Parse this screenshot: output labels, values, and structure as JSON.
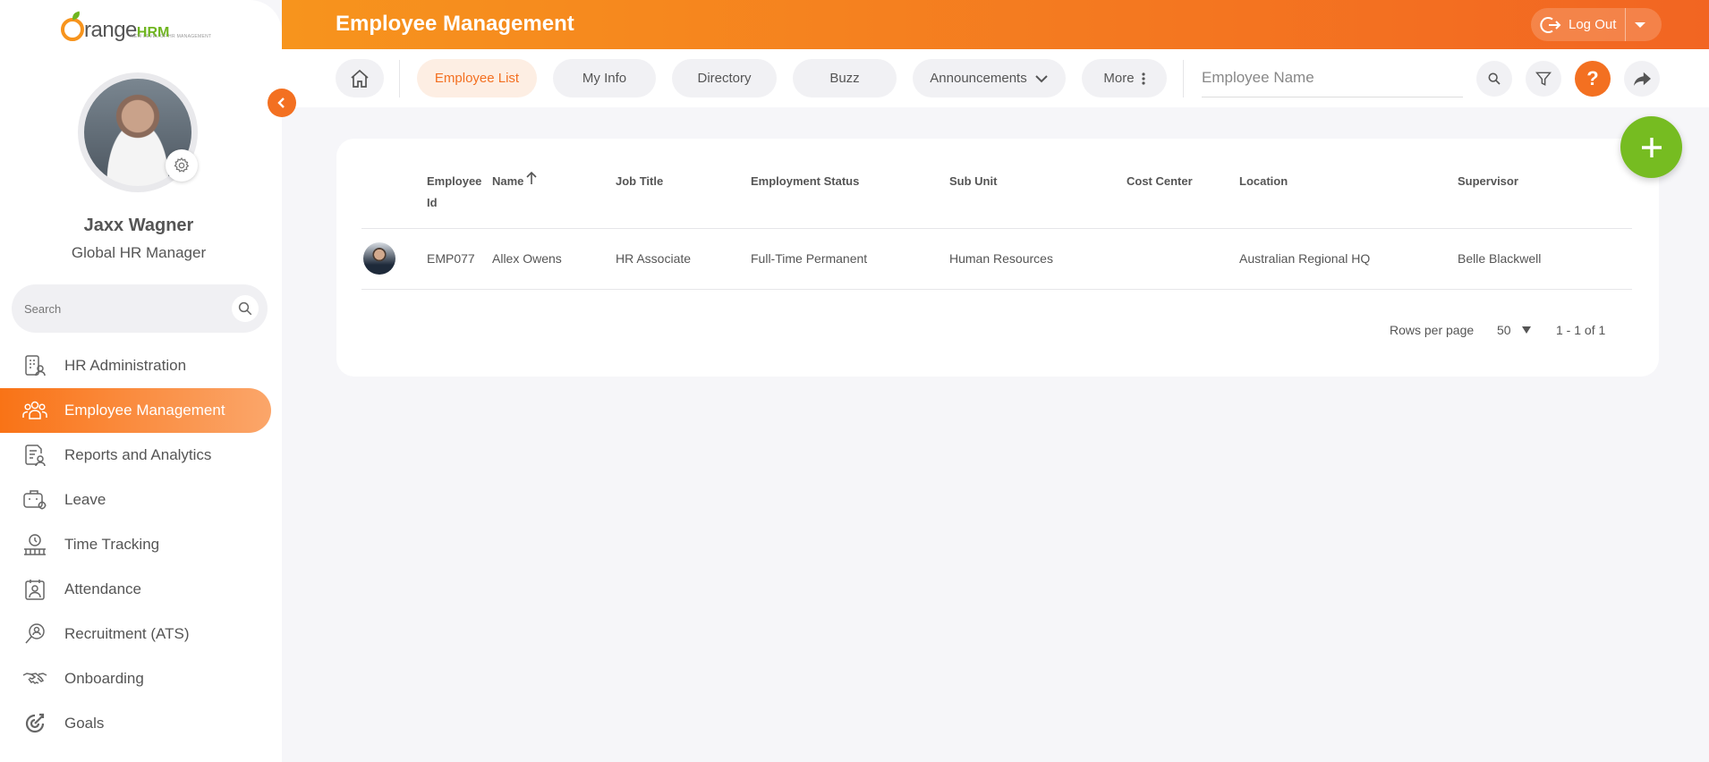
{
  "app": {
    "logo_text_main": "range",
    "logo_text_brand": "HRM",
    "logo_tagline": "NEW LEVEL OF HR MANAGEMENT"
  },
  "user": {
    "name": "Jaxx Wagner",
    "role": "Global HR Manager"
  },
  "sidebar": {
    "search_placeholder": "Search",
    "items": [
      {
        "label": "HR Administration",
        "icon": "hr-admin-icon",
        "active": false
      },
      {
        "label": "Employee Management",
        "icon": "employee-management-icon",
        "active": true
      },
      {
        "label": "Reports and Analytics",
        "icon": "reports-icon",
        "active": false
      },
      {
        "label": "Leave",
        "icon": "leave-icon",
        "active": false
      },
      {
        "label": "Time Tracking",
        "icon": "time-tracking-icon",
        "active": false
      },
      {
        "label": "Attendance",
        "icon": "attendance-icon",
        "active": false
      },
      {
        "label": "Recruitment (ATS)",
        "icon": "recruitment-icon",
        "active": false
      },
      {
        "label": "Onboarding",
        "icon": "onboarding-icon",
        "active": false
      },
      {
        "label": "Goals",
        "icon": "goals-icon",
        "active": false
      }
    ]
  },
  "header": {
    "title": "Employee Management",
    "logout_label": "Log Out"
  },
  "nav": {
    "tabs": [
      {
        "label": "Employee List",
        "active": true
      },
      {
        "label": "My Info",
        "active": false
      },
      {
        "label": "Directory",
        "active": false
      },
      {
        "label": "Buzz",
        "active": false
      },
      {
        "label": "Announcements",
        "active": false
      },
      {
        "label": "More",
        "active": false
      }
    ],
    "search_placeholder": "Employee Name",
    "help_label": "?"
  },
  "table": {
    "columns": [
      "Employee Id",
      "Name",
      "Job Title",
      "Employment Status",
      "Sub Unit",
      "Cost Center",
      "Location",
      "Supervisor"
    ],
    "rows": [
      {
        "employee_id": "EMP077",
        "name": "Allex Owens",
        "job_title": "HR Associate",
        "employment_status": "Full-Time Permanent",
        "sub_unit": "Human Resources",
        "cost_center": "",
        "location": "Australian Regional HQ",
        "supervisor": "Belle Blackwell"
      }
    ],
    "rows_per_page_label": "Rows per page",
    "rows_per_page_value": "50",
    "range_label": "1 - 1 of 1"
  },
  "colors": {
    "accent": "#f37021",
    "header_gradient_start": "#f7941d",
    "header_gradient_end": "#f26522",
    "fab": "#76bc21"
  }
}
